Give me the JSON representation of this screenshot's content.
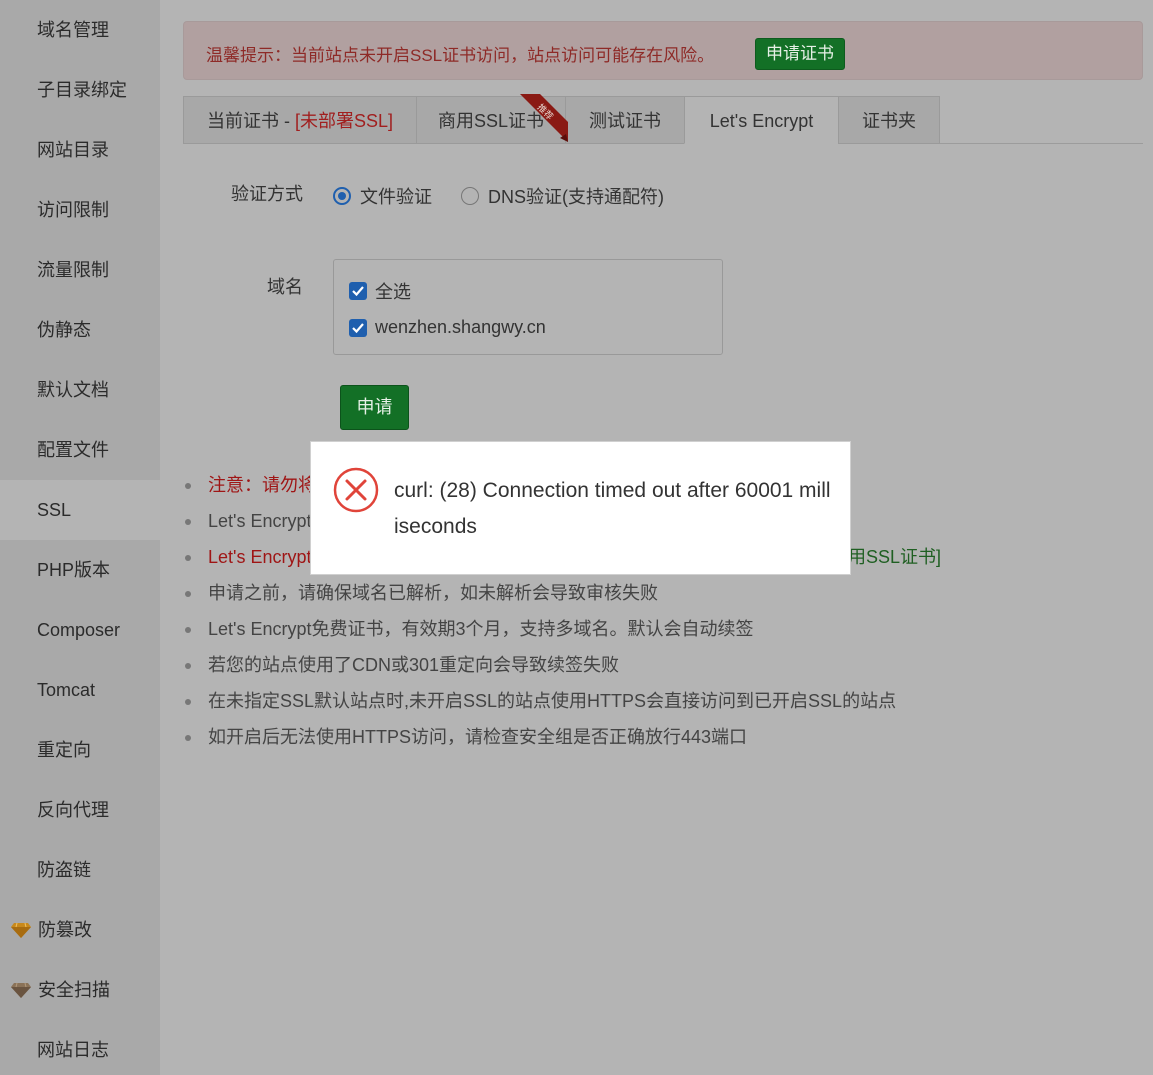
{
  "sidebar": {
    "items": [
      {
        "label": "域名管理"
      },
      {
        "label": "子目录绑定"
      },
      {
        "label": "网站目录"
      },
      {
        "label": "访问限制"
      },
      {
        "label": "流量限制"
      },
      {
        "label": "伪静态"
      },
      {
        "label": "默认文档"
      },
      {
        "label": "配置文件"
      },
      {
        "label": "SSL"
      },
      {
        "label": "PHP版本"
      },
      {
        "label": "Composer"
      },
      {
        "label": "Tomcat"
      },
      {
        "label": "重定向"
      },
      {
        "label": "反向代理"
      },
      {
        "label": "防盗链"
      },
      {
        "label": "防篡改"
      },
      {
        "label": "安全扫描"
      },
      {
        "label": "网站日志"
      }
    ],
    "active": "SSL",
    "gem_icon": "diamond-icon",
    "gem_color": "#c8891c"
  },
  "alert": {
    "text": "温馨提示：当前站点未开启SSL证书访问，站点访问可能存在风险。",
    "button": "申请证书"
  },
  "tabs": {
    "current_prefix": "当前证书 - ",
    "current_status": "[未部署SSL]",
    "commercial": "商用SSL证书",
    "ribbon": "推荐",
    "test": "测试证书",
    "letsencrypt": "Let's Encrypt",
    "folder": "证书夹",
    "active": "Let's Encrypt"
  },
  "form": {
    "verify_label": "验证方式",
    "radio_file": "文件验证",
    "radio_dns": "DNS验证(支持通配符)",
    "selected_method": "文件验证",
    "domain_label": "域名",
    "select_all": "全选",
    "domain": "wenzhen.shangwy.cn",
    "apply_button": "申请"
  },
  "notes": {
    "n1_visible": "注意：请勿将",
    "n2_visible": "Let's Encrypt",
    "n3_visible": "Let's Encrypt",
    "n3_link_tail": "用SSL证书]",
    "n4": "申请之前，请确保域名已解析，如未解析会导致审核失败",
    "n5": "Let's Encrypt免费证书，有效期3个月，支持多域名。默认会自动续签",
    "n6": "若您的站点使用了CDN或301重定向会导致续签失败",
    "n7": "在未指定SSL默认站点时,未开启SSL的站点使用HTTPS会直接访问到已开启SSL的站点",
    "n8": "如开启后无法使用HTTPS访问，请检查安全组是否正确放行443端口"
  },
  "modal": {
    "icon": "error-circle-x-icon",
    "message": "curl: (28) Connection timed out after 60001 milliseconds",
    "color": "#e0443a"
  }
}
